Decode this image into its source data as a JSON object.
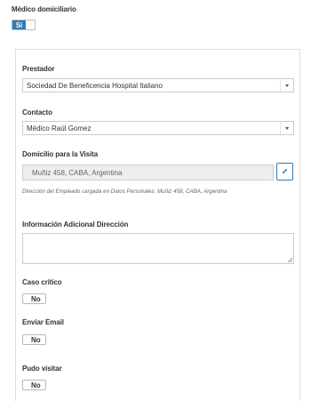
{
  "medico_domiciliario": {
    "label": "Médico domiciliario",
    "value": "Si"
  },
  "prestador": {
    "label": "Prestador",
    "value": "Sociedad De Beneficencia Hospital Italiano"
  },
  "contacto": {
    "label": "Contacto",
    "value": "Médico Raúl Gomez"
  },
  "domicilio": {
    "label": "Domicilio para la Visita",
    "value": "Muñiz 458, CABA, Argentina",
    "helper": "Dirección del Empleado cargada en Datos Personales: Muñiz 458, CABA, Argentina"
  },
  "info_adicional": {
    "label": "Información Adicional Dirección",
    "value": ""
  },
  "caso_critico": {
    "label": "Caso crítico",
    "value": "No"
  },
  "enviar_email": {
    "label": "Enviar Email",
    "value": "No"
  },
  "pudo_visitar": {
    "label": "Pudo visitar",
    "value": "No"
  },
  "colors": {
    "accent": "#2f7cb8",
    "border": "#cccccc",
    "disabled_bg": "#eeeeee"
  },
  "icons": {
    "select_caret": "caret-down-icon",
    "edit": "pencil-icon",
    "resize": "resize-grip-icon"
  }
}
